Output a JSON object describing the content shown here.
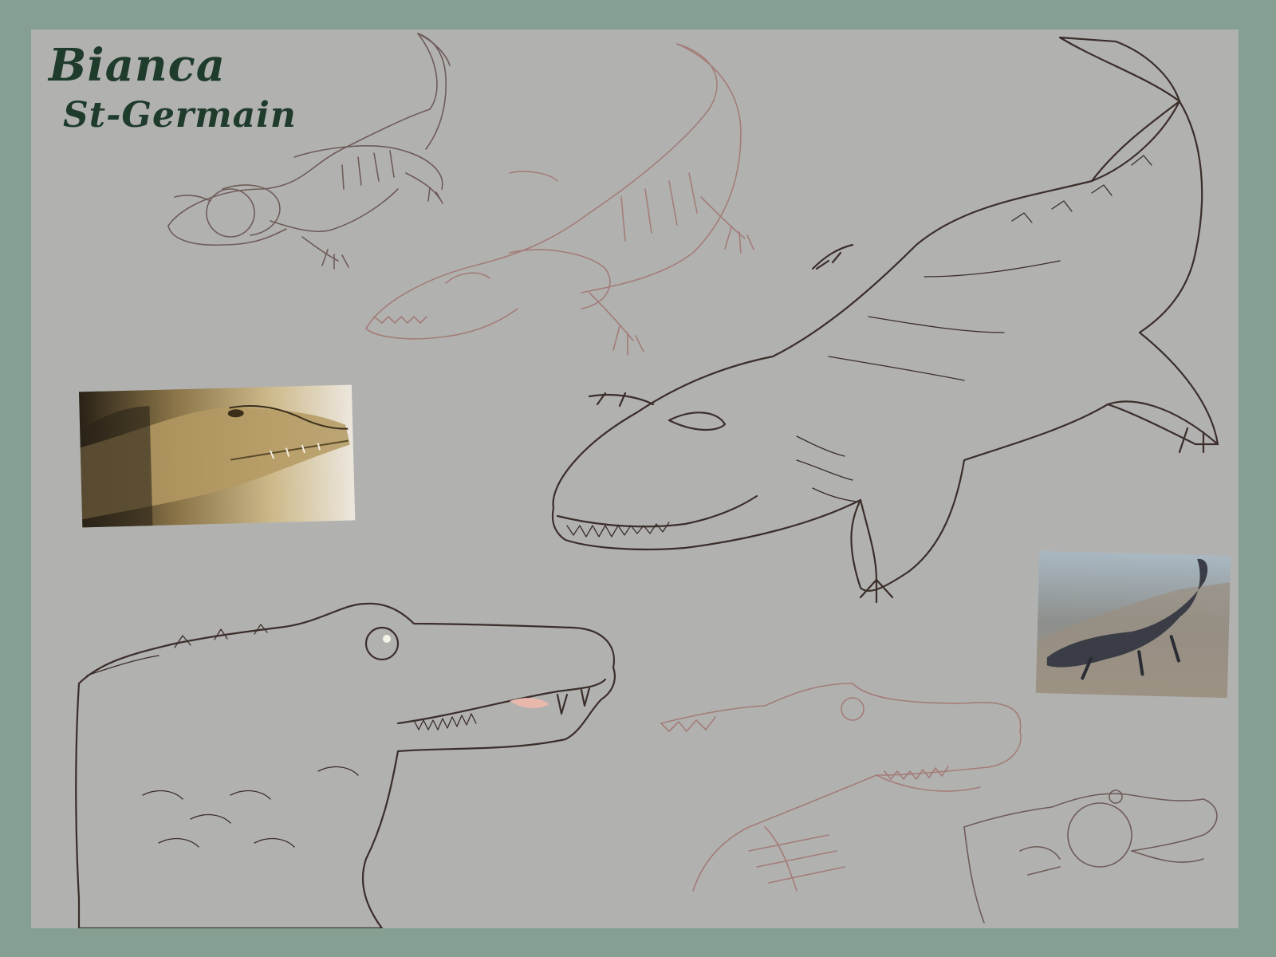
{
  "artist": {
    "name_line1": "Bianca",
    "name_line2": "St-Germain"
  },
  "colors": {
    "outer_frame": "#85a092",
    "canvas_background": "#b1b2b0",
    "title_ink": "#1f3b2b",
    "sketch_brown": "#6f5b58",
    "sketch_red": "#a47c78",
    "gator_body_green": "#5c7168",
    "gator_belly_light": "#9fb0a7",
    "head_study_cream": "#d8d7b6",
    "head_study_olive": "#8c8f74"
  },
  "artwork": {
    "pieces": [
      {
        "id": "gesture-sketch-1",
        "kind": "brown pencil sketch",
        "icon": "alligator-sketch"
      },
      {
        "id": "gesture-sketch-2",
        "kind": "red pencil sketch",
        "icon": "alligator-sketch"
      },
      {
        "id": "reference-photo-1",
        "kind": "photo reference, alligator head",
        "icon": "photo"
      },
      {
        "id": "painted-full-body",
        "kind": "digital painting, full-body alligator",
        "icon": "alligator"
      },
      {
        "id": "reference-photo-2",
        "kind": "photo reference, alligator on concrete",
        "icon": "photo"
      },
      {
        "id": "painted-head-study",
        "kind": "digital painting, alligator head",
        "icon": "alligator-head"
      },
      {
        "id": "head-sketch-1",
        "kind": "red pencil head sketch",
        "icon": "alligator-head-sketch"
      },
      {
        "id": "head-sketch-2",
        "kind": "brown pencil head construction",
        "icon": "alligator-head-sketch"
      }
    ]
  }
}
